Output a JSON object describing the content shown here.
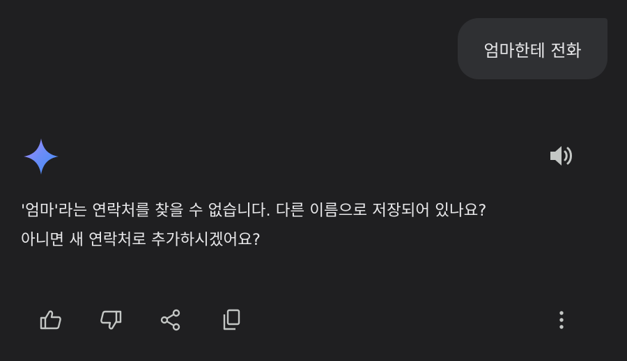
{
  "conversation": {
    "user_message": "엄마한테 전화",
    "assistant": {
      "avatar_icon": "gemini-sparkle-icon",
      "speak_icon": "speaker-icon",
      "response_lines": [
        "'엄마'라는 연락처를 찾을 수 없습니다. 다른 이름으로 저장되어 있나요?",
        "아니면 새 연락처로 추가하시겠어요?"
      ]
    }
  },
  "actions": {
    "like_icon": "thumbs-up-icon",
    "dislike_icon": "thumbs-down-icon",
    "share_icon": "share-icon",
    "copy_icon": "copy-icon",
    "more_icon": "more-vert-icon"
  },
  "colors": {
    "background": "#1f1f21",
    "bubble": "#2f3033",
    "text": "#e8e8ea",
    "icon": "#c4c7c5",
    "sparkle_start": "#9b72f2",
    "sparkle_end": "#4285f4"
  }
}
